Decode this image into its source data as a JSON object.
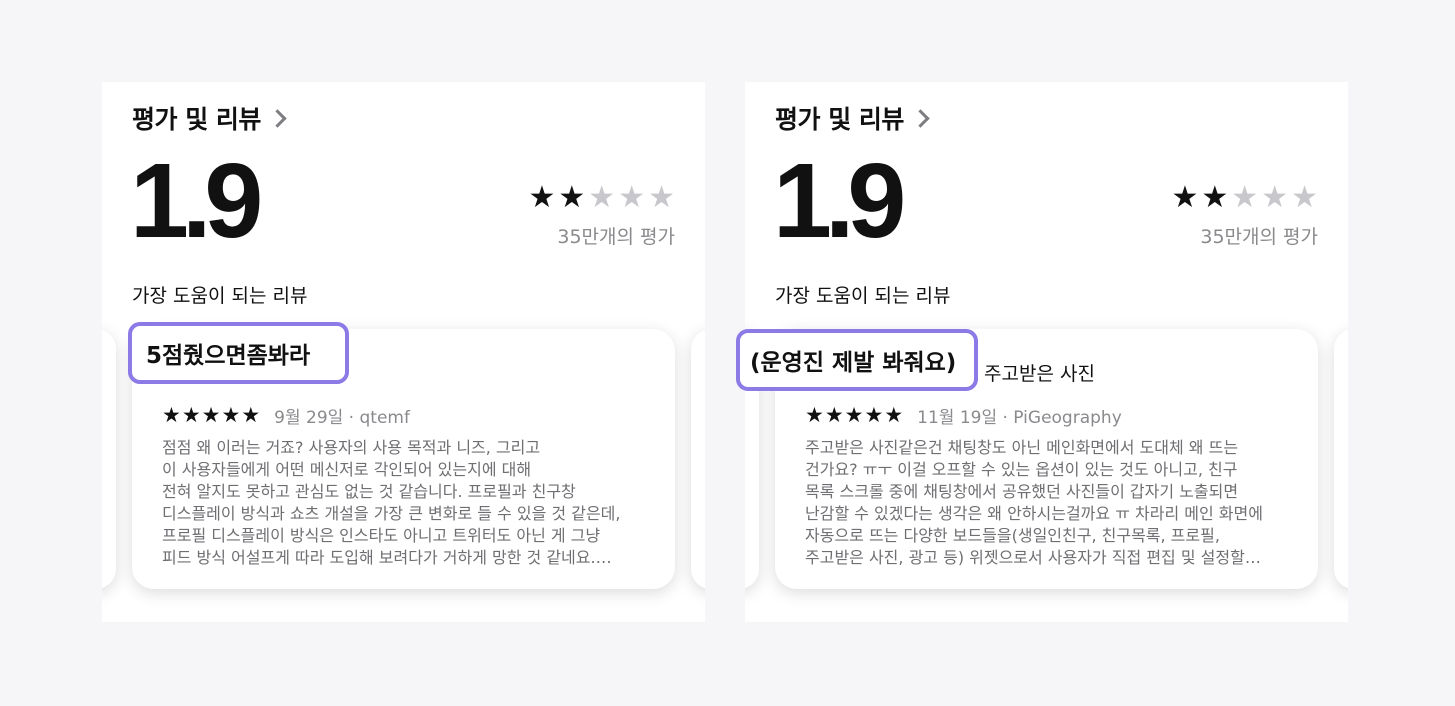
{
  "panels": [
    {
      "section_title": "평가 및 리뷰",
      "average_rating": "1.9",
      "stars": {
        "filled": 2,
        "total": 5
      },
      "rating_count": "35만개의 평가",
      "subheading": "가장 도움이 되는 리뷰",
      "review": {
        "title": "5점줬으면좀봐라",
        "rating": 5,
        "date": "9월 29일 · qtemf",
        "body_lines": [
          "           점점 왜 이러는 거죠? 사용자의 사용 목적과 니즈, 그리고",
          "           이 사용자들에게 어떤 메신저로 각인되어 있는지에 대해",
          "전혀 알지도 못하고 관심도 없는 것 같습니다. 프로필과 친구창",
          "디스플레이 방식과 쇼츠 개설을 가장 큰 변화로 들 수 있을 것 같은데,",
          "프로필 디스플레이 방식은 인스타도 아니고 트위터도 아닌 게 그냥",
          "피드 방식 어설프게 따라 도입해 보려다가 거하게 망한 것 같네요.…"
        ]
      },
      "highlight": "5점줬으면좀봐라"
    },
    {
      "section_title": "평가 및 리뷰",
      "average_rating": "1.9",
      "stars": {
        "filled": 2,
        "total": 5
      },
      "rating_count": "35만개의 평가",
      "subheading": "가장 도움이 되는 리뷰",
      "review": {
        "title": "주고받은 사진",
        "rating": 5,
        "date": "11월 19일 · PiGeography",
        "body_lines": [
          "주고받은 사진같은건 채팅창도 아닌 메인화면에서 도대체 왜 뜨는",
          "건가요? ㅠㅜ 이걸 오프할 수 있는 옵션이 있는 것도 아니고, 친구",
          "목록 스크롤 중에 채팅창에서 공유했던 사진들이 갑자기 노출되면",
          "난감할 수 있겠다는 생각은 왜 안하시는걸까요 ㅠ 차라리 메인 화면에",
          "자동으로 뜨는 다양한 보드들을(생일인친구, 친구목록, 프로필,",
          "주고받은 사진, 광고 등) 위젯으로서 사용자가 직접 편집 및 설정할…"
        ]
      },
      "highlight": "(운영진 제발 봐줘요)"
    }
  ],
  "colors": {
    "page_background": "#f6f6f8",
    "highlight_border": "#8c7ae6",
    "star_on": "#111111",
    "star_off": "#c8c8cc",
    "secondary_text": "#8a8a8e"
  },
  "icons": {
    "chevron": "chevron-right-icon",
    "star": "star-icon"
  }
}
